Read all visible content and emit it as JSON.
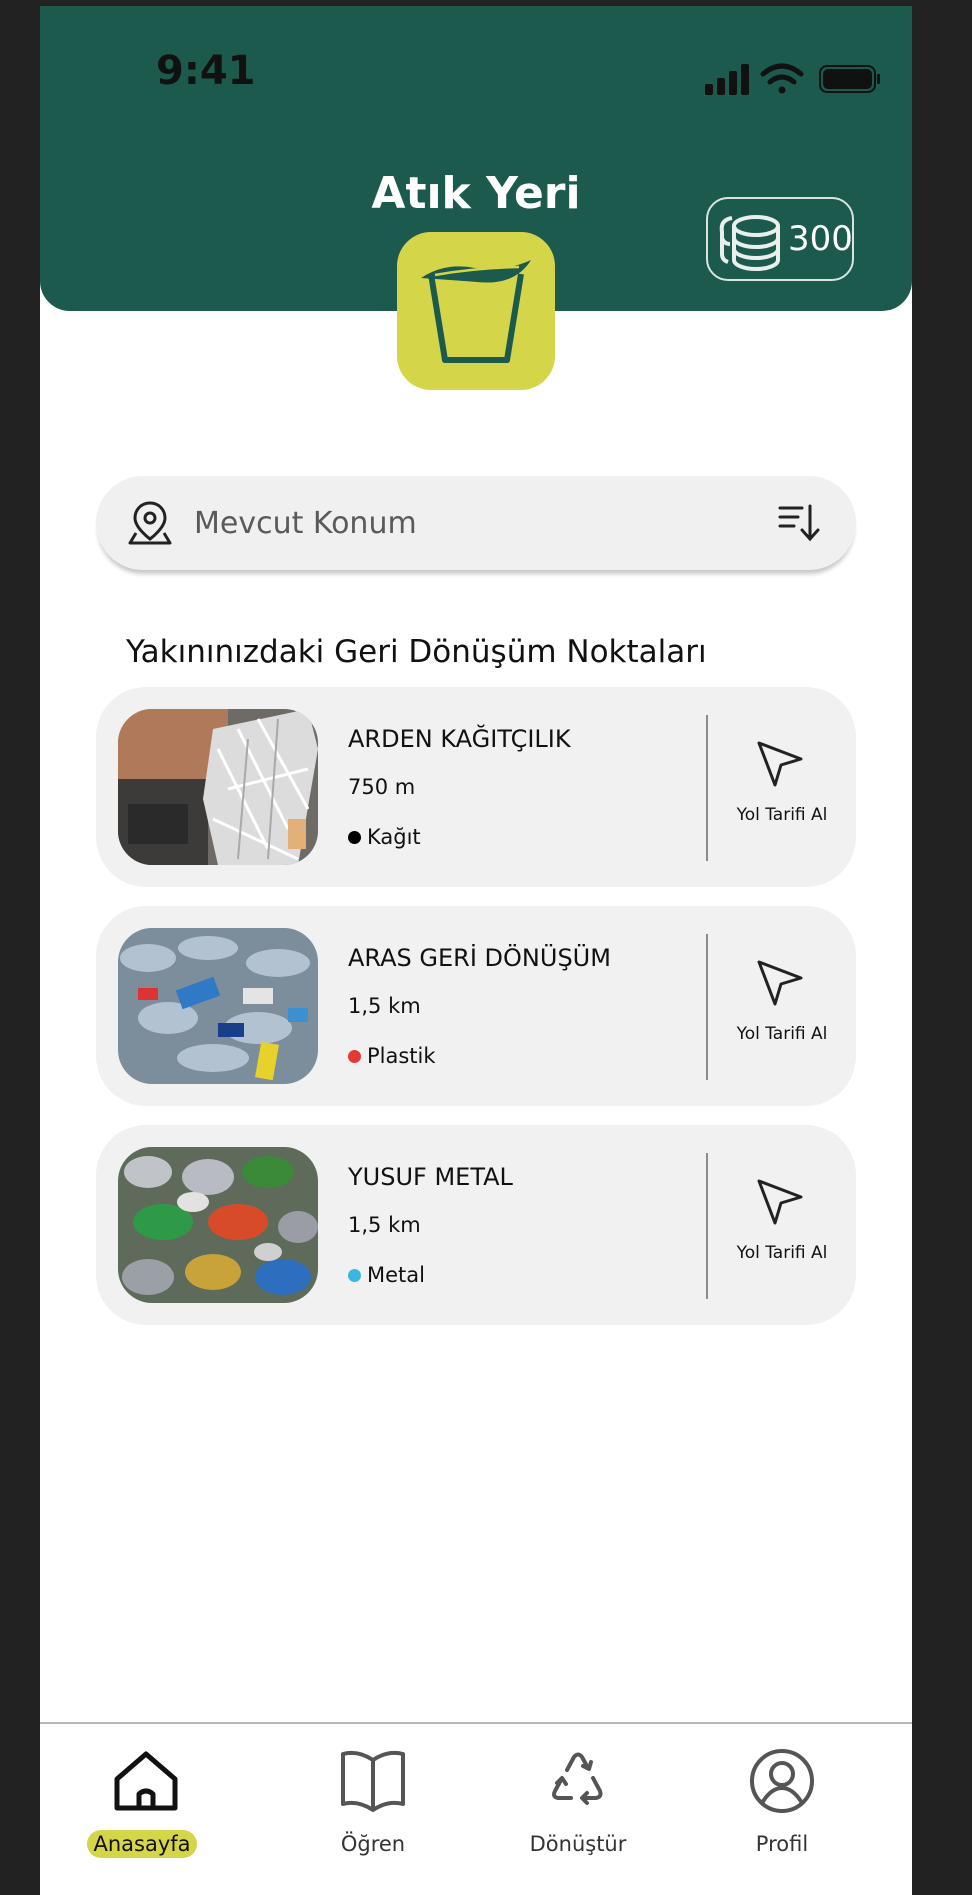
{
  "status_bar": {
    "time": "9:41"
  },
  "header": {
    "title": "Atık Yeri",
    "coins": "300",
    "colors": {
      "header_bg": "#1b5a4c",
      "accent": "#d5d54a"
    }
  },
  "search": {
    "placeholder": "Mevcut Konum",
    "value": ""
  },
  "section": {
    "title": "Yakınınızdaki Geri Dönüşüm Noktaları"
  },
  "recycling_points": [
    {
      "name": "ARDEN KAĞITÇILIK",
      "distance": "750 m",
      "category": "Kağıt",
      "category_color": "#000000",
      "directions_label": "Yol Tarifi Al",
      "image": "shredded-paper-photo"
    },
    {
      "name": "ARAS GERİ DÖNÜŞÜM",
      "distance": "1,5 km",
      "category": "Plastik",
      "category_color": "#e53935",
      "directions_label": "Yol Tarifi Al",
      "image": "plastic-bottles-photo"
    },
    {
      "name": "YUSUF METAL",
      "distance": "1,5 km",
      "category": "Metal",
      "category_color": "#3ab7e0",
      "directions_label": "Yol Tarifi Al",
      "image": "crushed-cans-photo"
    }
  ],
  "bottom_nav": {
    "items": [
      {
        "label": "Anasayfa",
        "icon": "home-icon",
        "active": true
      },
      {
        "label": "Öğren",
        "icon": "book-icon",
        "active": false
      },
      {
        "label": "Dönüştür",
        "icon": "recycle-icon",
        "active": false
      },
      {
        "label": "Profil",
        "icon": "profile-icon",
        "active": false
      }
    ]
  }
}
